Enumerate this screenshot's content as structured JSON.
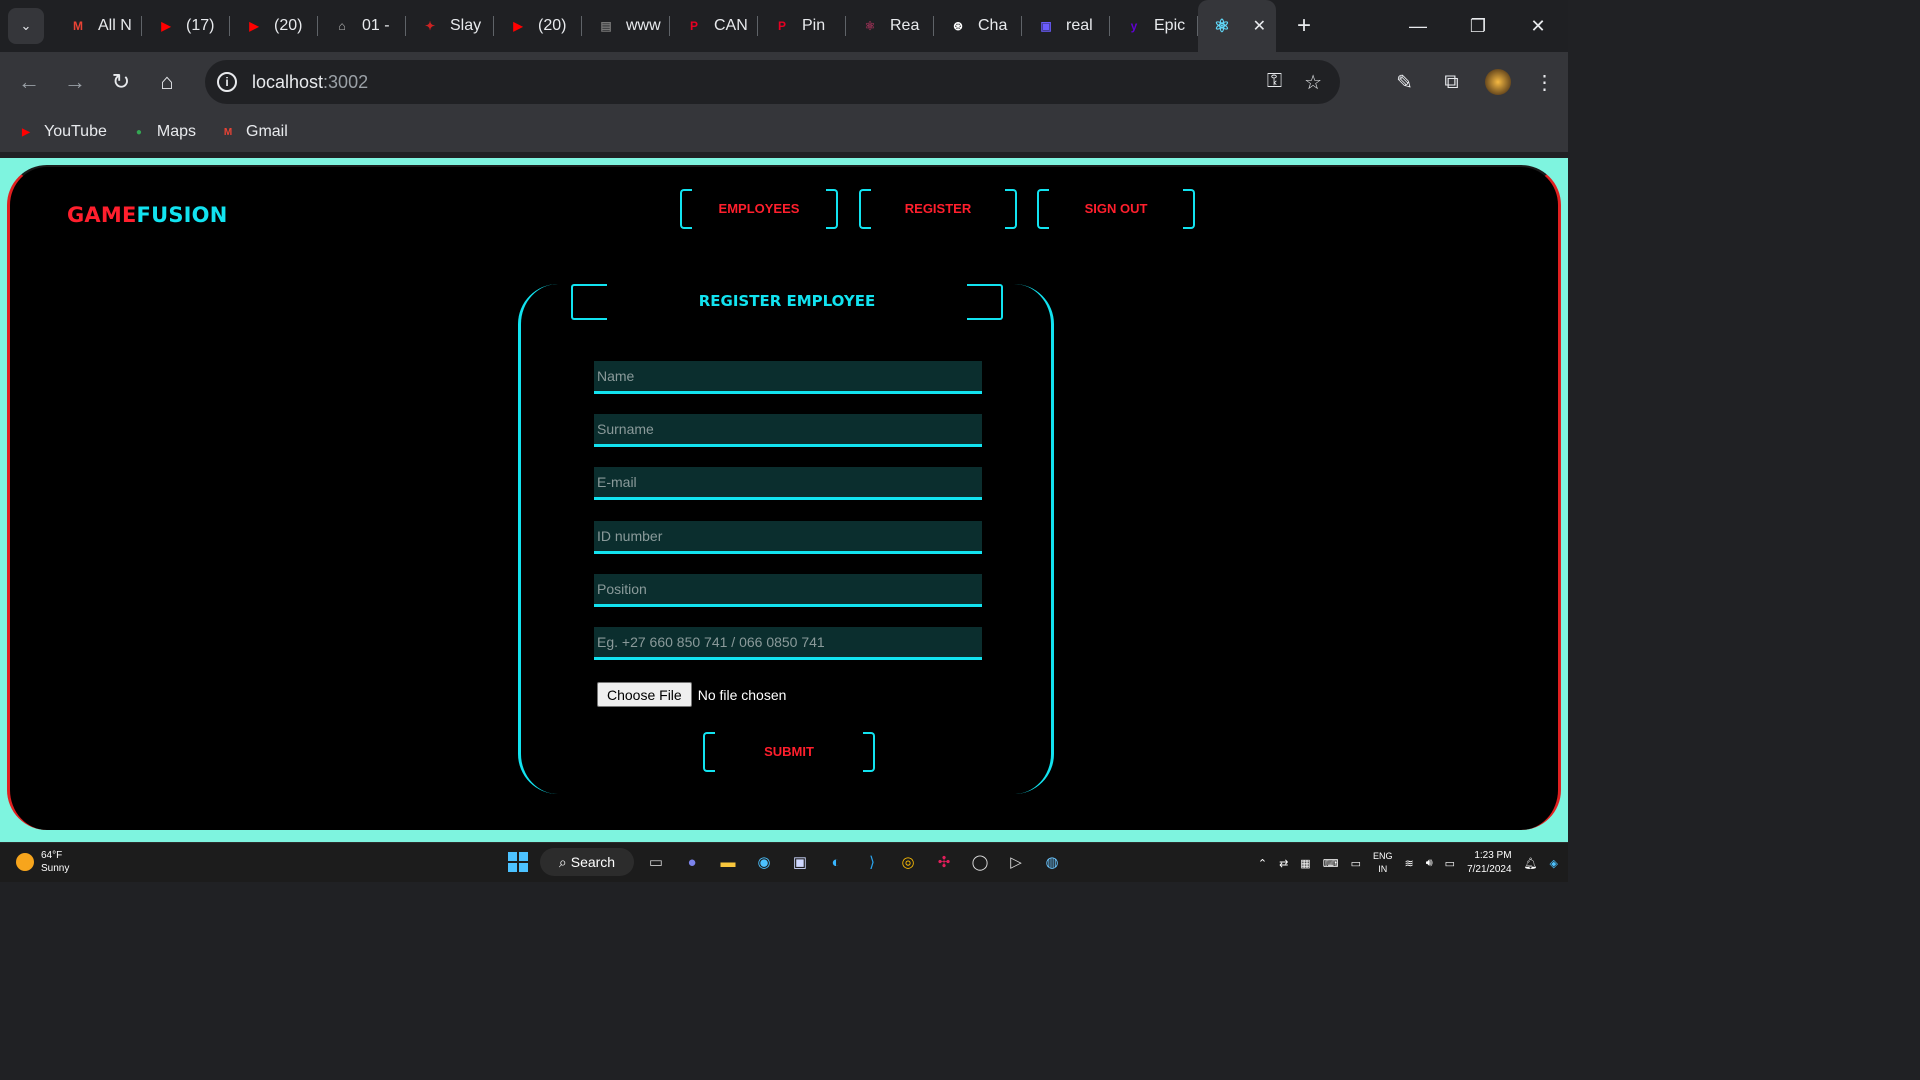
{
  "browser": {
    "tabs": [
      {
        "title": "All N",
        "icon": "gmail-icon",
        "color": "#ea4335",
        "glyph": "M"
      },
      {
        "title": "(17)",
        "icon": "youtube-icon",
        "color": "#ff0000",
        "glyph": "▶"
      },
      {
        "title": "(20)",
        "icon": "youtube-icon",
        "color": "#ff0000",
        "glyph": "▶"
      },
      {
        "title": "01 -",
        "icon": "building-icon",
        "color": "#bbbbbb",
        "glyph": "⌂"
      },
      {
        "title": "Slay",
        "icon": "slayer-icon",
        "color": "#cc2222",
        "glyph": "✦"
      },
      {
        "title": "(20)",
        "icon": "youtube-icon",
        "color": "#ff0000",
        "glyph": "▶"
      },
      {
        "title": "www",
        "icon": "page-icon",
        "color": "#777777",
        "glyph": "▤"
      },
      {
        "title": "CAN",
        "icon": "pinterest-icon",
        "color": "#e60023",
        "glyph": "P"
      },
      {
        "title": "Pin",
        "icon": "pinterest-icon",
        "color": "#e60023",
        "glyph": "P"
      },
      {
        "title": "Rea",
        "icon": "react-icon",
        "color": "#8b2f4f",
        "glyph": "⚛"
      },
      {
        "title": "Cha",
        "icon": "chatgpt-icon",
        "color": "#ffffff",
        "glyph": "⊛"
      },
      {
        "title": "real",
        "icon": "app-icon",
        "color": "#6a5cff",
        "glyph": "▣"
      },
      {
        "title": "Epic",
        "icon": "yahoo-icon",
        "color": "#6001d2",
        "glyph": "y"
      }
    ],
    "active_tab_icon": "react-icon",
    "active_tab_glyph": "⚛",
    "close_glyph": "✕",
    "new_tab_glyph": "+",
    "url_host": "localhost",
    "url_port": ":3002",
    "bookmarks": [
      {
        "label": "YouTube",
        "icon": "youtube-icon",
        "color": "#ff0000",
        "glyph": "▶"
      },
      {
        "label": "Maps",
        "icon": "maps-icon",
        "color": "#34a853",
        "glyph": "●"
      },
      {
        "label": "Gmail",
        "icon": "gmail-icon",
        "color": "#ea4335",
        "glyph": "M"
      }
    ]
  },
  "app": {
    "logo_part1": "GAME",
    "logo_part2": "FUSION",
    "nav": {
      "employees": "EMPLOYEES",
      "register": "REGISTER",
      "sign_out": "SIGN OUT"
    },
    "form": {
      "title": "REGISTER EMPLOYEE",
      "name_placeholder": "Name",
      "surname_placeholder": "Surname",
      "email_placeholder": "E-mail",
      "id_placeholder": "ID number",
      "position_placeholder": "Position",
      "phone_placeholder": "Eg. +27 660 850 741 / 066 0850 741",
      "file_button": "Choose File",
      "file_status": "No file chosen",
      "submit": "SUBMIT"
    },
    "colors": {
      "accent_cyan": "#12e3f0",
      "accent_red": "#ff1f2d",
      "frame": "#7ef4df"
    }
  },
  "taskbar": {
    "weather_temp": "64°F",
    "weather_desc": "Sunny",
    "search_label": "Search",
    "lang_top": "ENG",
    "lang_bottom": "IN",
    "time": "1:23 PM",
    "date": "7/21/2024"
  }
}
